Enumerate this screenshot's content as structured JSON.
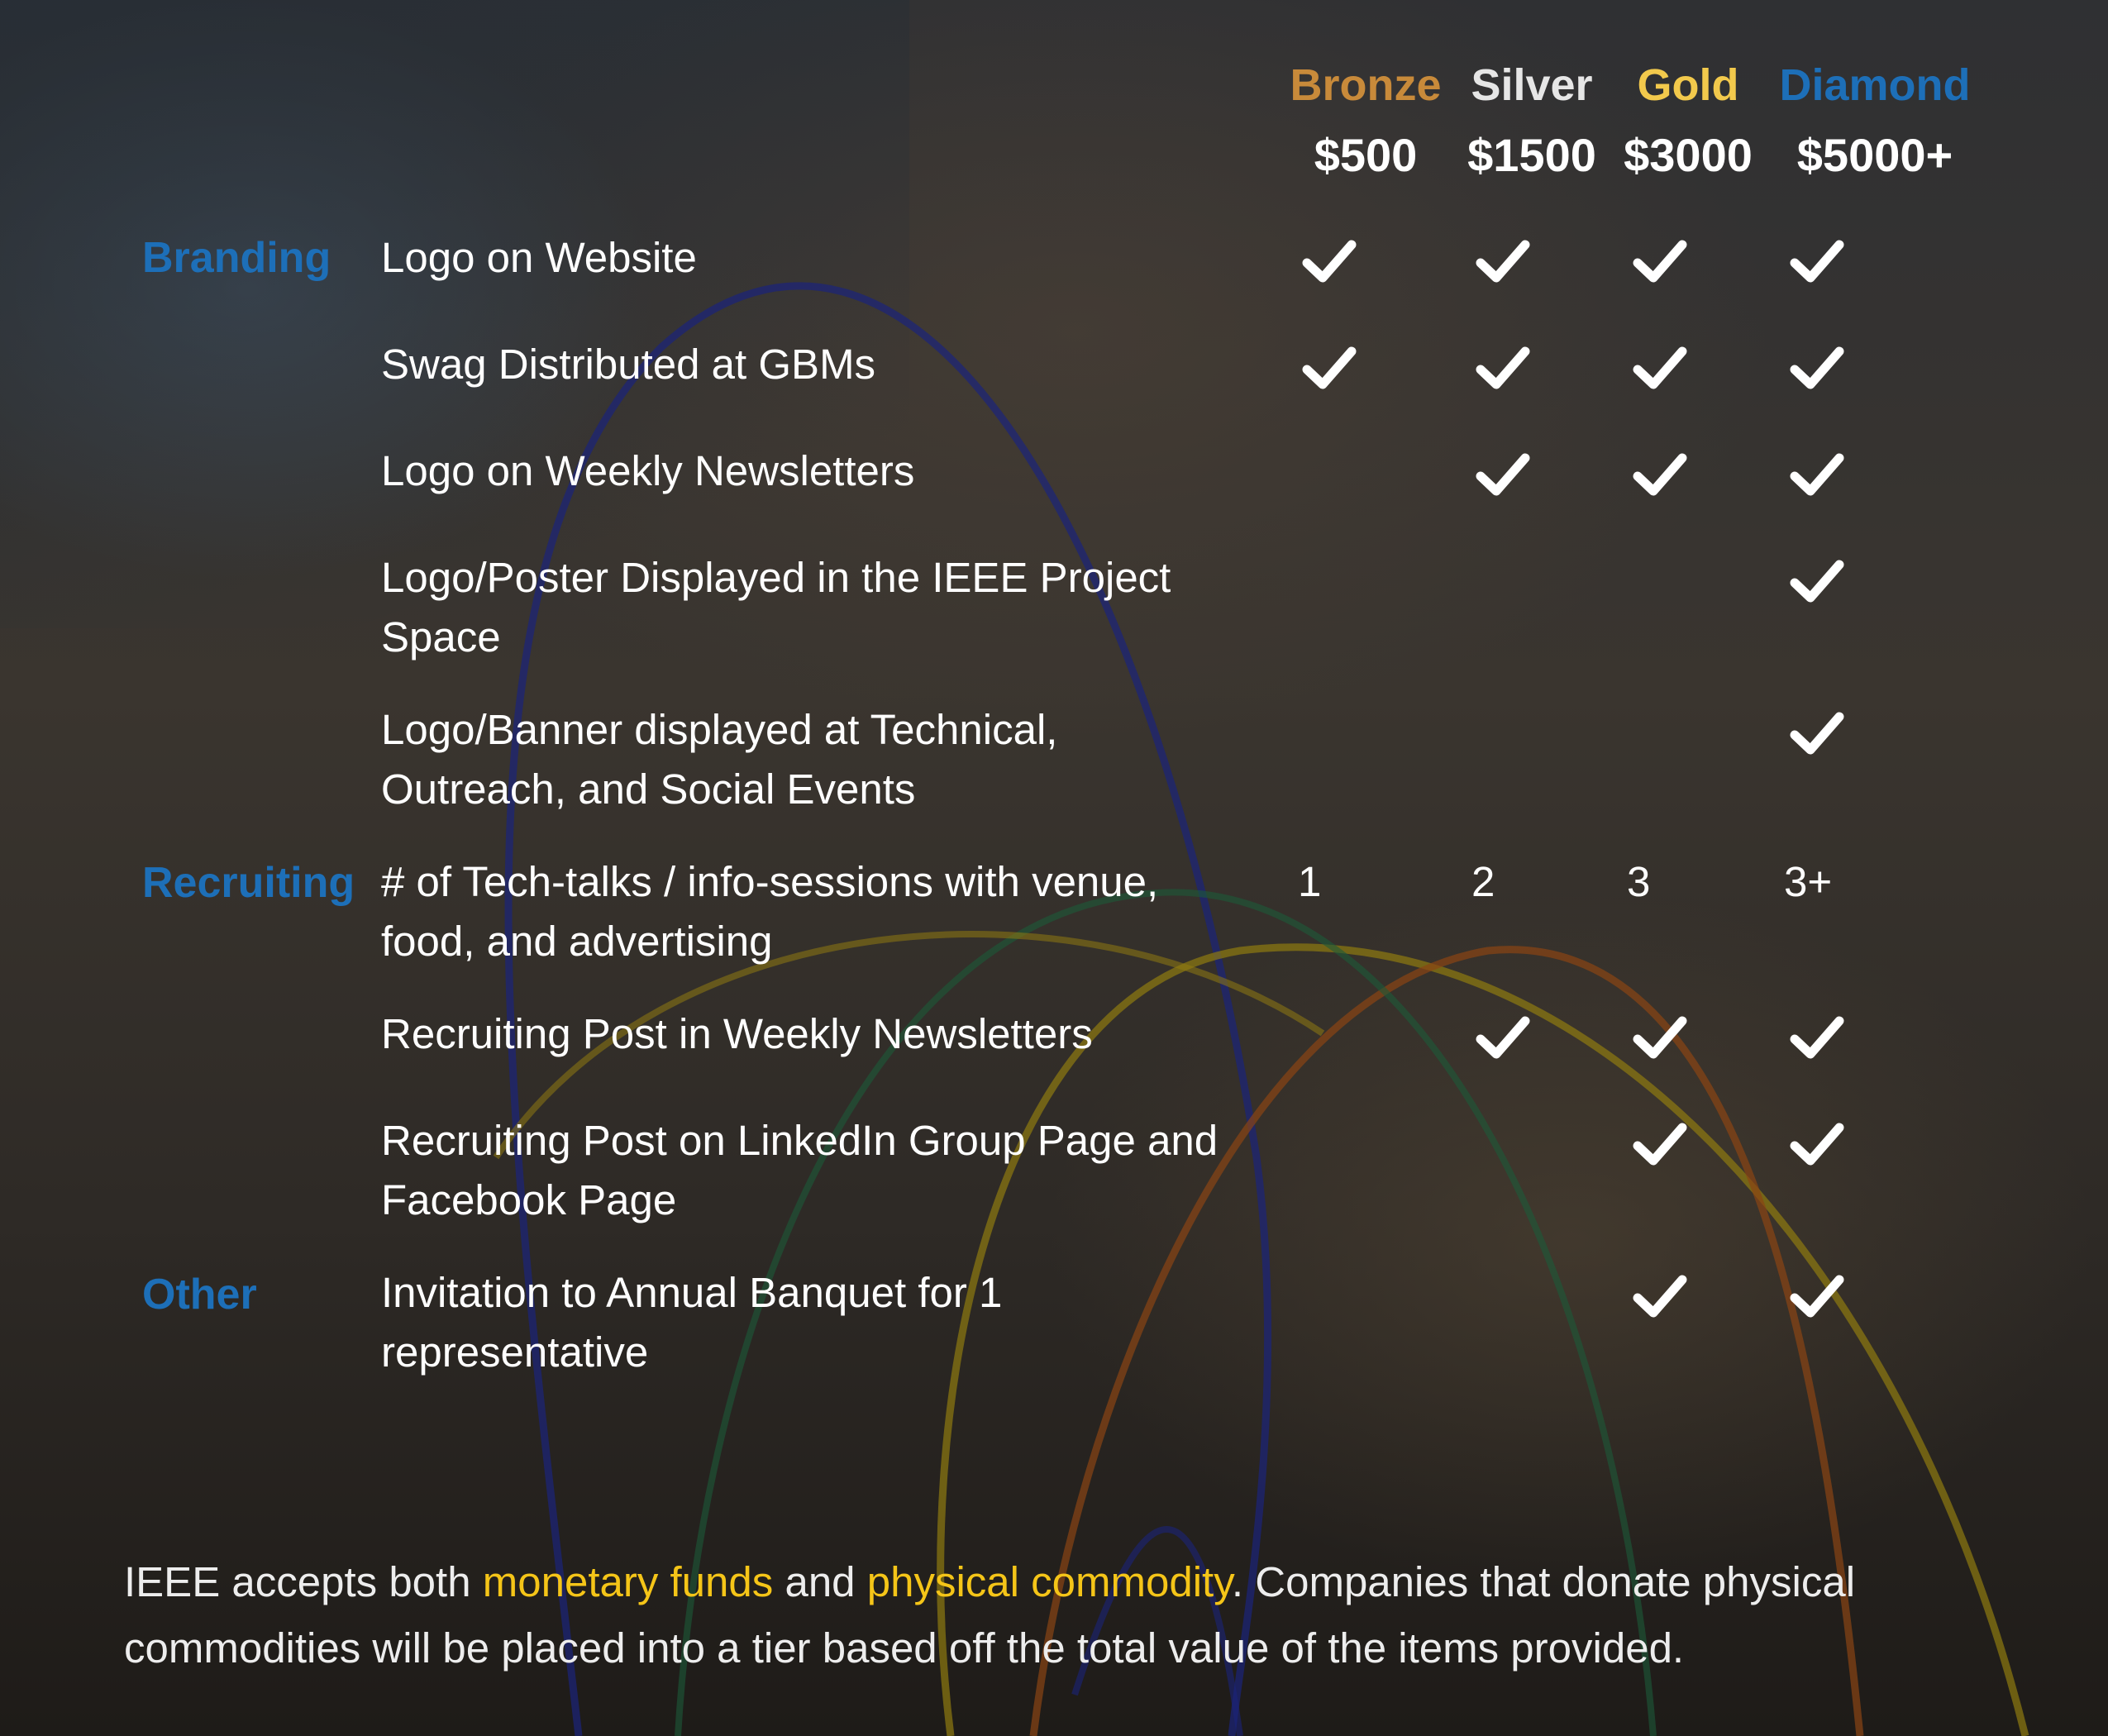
{
  "colors": {
    "bronze": "#c88a3a",
    "silver": "#e6e6e6",
    "gold": "#f2c94c",
    "diamond": "#1d6fb8",
    "category": "#1d6fb8",
    "highlight": "#f5c518"
  },
  "tiers": [
    {
      "name": "Bronze",
      "price": "$500"
    },
    {
      "name": "Silver",
      "price": "$1500"
    },
    {
      "name": "Gold",
      "price": "$3000"
    },
    {
      "name": "Diamond",
      "price": "$5000+"
    }
  ],
  "categories": {
    "branding": "Branding",
    "recruiting": "Recruiting",
    "other": "Other"
  },
  "rows": [
    {
      "feature": "Logo on Website",
      "marks": [
        "check",
        "check",
        "check",
        "check"
      ]
    },
    {
      "feature": "Swag Distributed at GBMs",
      "marks": [
        "check",
        "check",
        "check",
        "check"
      ]
    },
    {
      "feature": "Logo on Weekly Newsletters",
      "marks": [
        "",
        "check",
        "check",
        "check"
      ]
    },
    {
      "feature": "Logo/Poster Displayed in the IEEE Project Space",
      "marks": [
        "",
        "",
        "",
        "check"
      ]
    },
    {
      "feature": "Logo/Banner displayed at Technical, Outreach, and Social Events",
      "marks": [
        "",
        "",
        "",
        "check"
      ]
    },
    {
      "feature": "# of Tech-talks / info-sessions with venue, food, and advertising",
      "counts": [
        "1",
        "2",
        "3",
        "3+"
      ]
    },
    {
      "feature": "Recruiting Post in Weekly Newsletters",
      "marks": [
        "",
        "check",
        "check",
        "check"
      ]
    },
    {
      "feature": "Recruiting Post on LinkedIn Group Page and Facebook Page",
      "marks": [
        "",
        "",
        "check",
        "check"
      ]
    },
    {
      "feature": "Invitation to Annual Banquet for 1 representative",
      "marks": [
        "",
        "",
        "check",
        "check"
      ]
    }
  ],
  "footer": {
    "part1": "IEEE accepts both ",
    "highlight1": "monetary funds",
    "part2": " and ",
    "highlight2": "physical commodity",
    "part3": ". Companies that donate physical commodities will be placed into a tier based off the total value of the items provided."
  }
}
